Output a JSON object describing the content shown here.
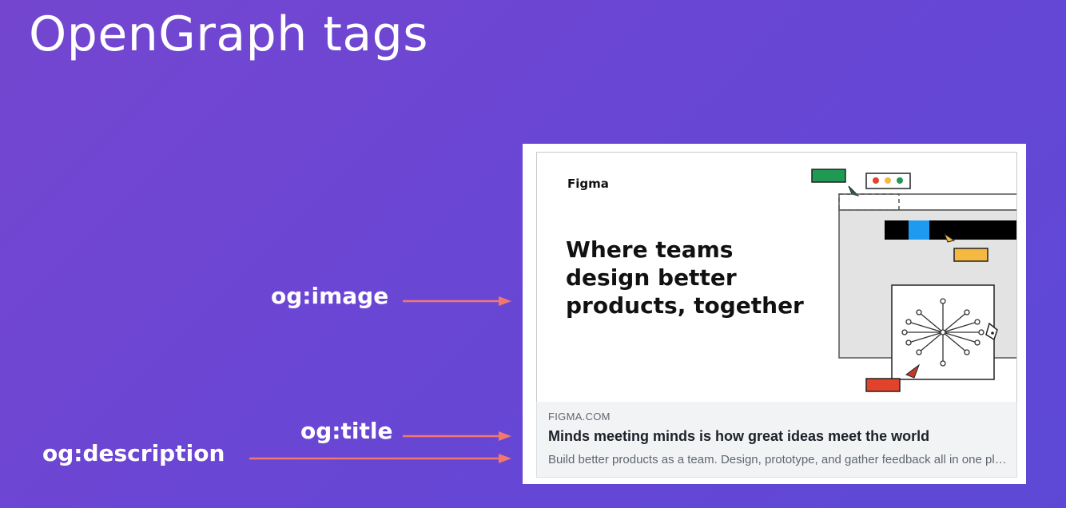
{
  "slide": {
    "title": "OpenGraph tags"
  },
  "labels": {
    "image": "og:image",
    "title": "og:title",
    "description": "og:description"
  },
  "card": {
    "brand": "Figma",
    "headline": "Where teams design better products, together",
    "site": "FIGMA.COM",
    "title": "Minds meeting minds is how great ideas meet the world",
    "description": "Build better products as a team. Design, prototype, and gather feedback all in one place with Figma."
  },
  "colors": {
    "arrow": "#f0786e",
    "green": "#1f9a55",
    "blue": "#1e9bf0",
    "yellow": "#f5b942",
    "red": "#e2432a"
  },
  "icons": [
    "arrow-right-icon",
    "cursor-icon",
    "pen-tool-icon",
    "traffic-lights-icon"
  ]
}
